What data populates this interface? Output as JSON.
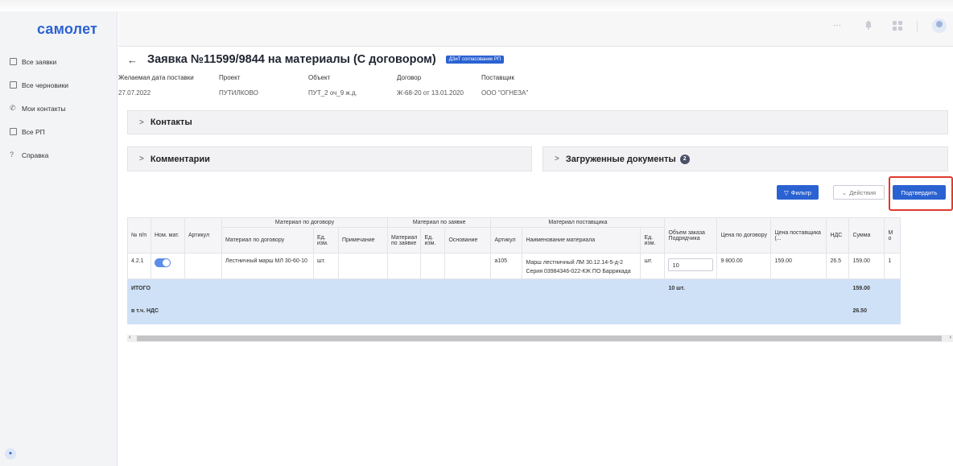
{
  "app": {
    "logo": "самолет"
  },
  "sidebar": {
    "items": [
      {
        "label": "Все заявки",
        "icon": "table-icon"
      },
      {
        "label": "Все черновики",
        "icon": "table-icon"
      },
      {
        "label": "Мои контакты",
        "icon": "phone-icon"
      },
      {
        "label": "Все РП",
        "icon": "table-icon"
      },
      {
        "label": "Справка",
        "icon": "help-icon"
      }
    ]
  },
  "topbar": {
    "more": "···"
  },
  "header": {
    "back": "←",
    "title": "Заявка №11599/9844 на материалы (С договором)",
    "badge": "ДЗиТ согласование РП"
  },
  "meta": [
    {
      "label": "Желаемая дата поставки",
      "value": "27.07.2022"
    },
    {
      "label": "Проект",
      "value": "ПУТИЛКОВО"
    },
    {
      "label": "Объект",
      "value": "ПУТ_2 оч_9 ж.д."
    },
    {
      "label": "Договор",
      "value": "Ж-68-20 от 13.01.2020"
    },
    {
      "label": "Поставщик",
      "value": "ООО \"ОГНЕЗА\""
    }
  ],
  "panels": {
    "chevron": ">",
    "contacts": "Контакты",
    "comments": "Комментарии",
    "documents": "Загруженные документы",
    "documents_count": "2"
  },
  "toolbar": {
    "filter": "Фильтр",
    "actions": "Действия",
    "confirm": "Подтвердить"
  },
  "table": {
    "groups": {
      "contract": "Материал по договору",
      "request": "Материал по заявке",
      "supplier": "Материал поставщика"
    },
    "headers": {
      "num": "№ п/п",
      "nom": "Ном. мат.",
      "article": "Артикул",
      "c_material": "Материал по договору",
      "c_unit": "Ед. изм.",
      "c_note": "Примечание",
      "r_material": "Материал по заявке",
      "r_unit": "Ед. изм.",
      "r_basis": "Основание",
      "s_article": "Артикул",
      "s_name": "Наименование материала",
      "s_unit": "Ед. изм.",
      "volume": "Объем заказа Подрядчика",
      "price_contract": "Цена по договору",
      "price_supplier": "Цена поставщика (...",
      "vat": "НДС",
      "sum": "Сумма",
      "more": "М о"
    },
    "row": {
      "num": "4.2.1",
      "c_material": "Лестничный марш МЛ 30-60-10",
      "c_unit": "шт.",
      "s_article": "a105",
      "s_name": "Марш лестничный ЛМ 30.12.14-5-д-2 Серия 03984346-022-КЖ ПО Баррикада",
      "s_unit": "шт.",
      "volume": "10",
      "price_contract": "9 800.00",
      "price_supplier": "159.00",
      "vat": "26.5",
      "sum": "159.00",
      "more": "1"
    },
    "total": {
      "label": "ИТОГО",
      "volume": "10 шт.",
      "sum": "159.00"
    },
    "vat_row": {
      "label": "в т.ч. НДС",
      "sum": "26.50"
    }
  },
  "scroll": {
    "left": "‹",
    "right": "›"
  }
}
